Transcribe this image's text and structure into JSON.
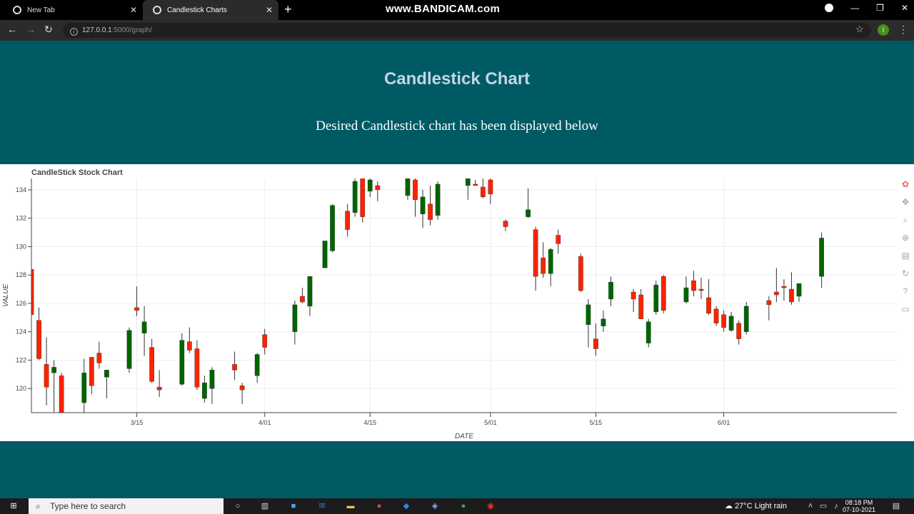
{
  "browser": {
    "tabs": [
      {
        "label": "New Tab",
        "active": false
      },
      {
        "label": "Candlestick Charts",
        "active": true
      }
    ],
    "watermark": "www.BANDICAM.com",
    "url_host": "127.0.0.1",
    "url_path": ":5000/graph/",
    "profile_initial": "I"
  },
  "page": {
    "title": "Candlestick Chart",
    "subtitle": "Desired Candlestick chart has been displayed below"
  },
  "chart_data": {
    "type": "candlestick",
    "title": "CandleStick Stock Chart",
    "xlabel": "DATE",
    "ylabel": "VALUE",
    "ylim": [
      118.3,
      134.8
    ],
    "y_ticks": [
      120,
      122,
      124,
      126,
      128,
      130,
      132,
      134
    ],
    "y_tick_labels": [
      "120",
      "122",
      "124",
      "126",
      "128",
      "130",
      "132",
      "134"
    ],
    "x_range": [
      "2021-03-01",
      "2021-06-24"
    ],
    "x_ticks": [
      "2021-03-15",
      "2021-04-01",
      "2021-04-15",
      "2021-05-01",
      "2021-05-15",
      "2021-06-01"
    ],
    "x_tick_labels": [
      "3/15",
      "4/01",
      "4/15",
      "5/01",
      "5/15",
      "6/01"
    ],
    "grid": true,
    "colors": {
      "up": "#006400",
      "down": "#ff2200",
      "wick": "#333333"
    },
    "candles": [
      {
        "date": "2021-03-01",
        "open": 128.4,
        "high": 128.7,
        "low": 125.2,
        "close": 125.2
      },
      {
        "date": "2021-03-02",
        "open": 124.8,
        "high": 125.7,
        "low": 122.0,
        "close": 122.1
      },
      {
        "date": "2021-03-03",
        "open": 121.7,
        "high": 123.6,
        "low": 118.8,
        "close": 120.1
      },
      {
        "date": "2021-03-04",
        "open": 121.1,
        "high": 122.0,
        "low": 118.3,
        "close": 121.5
      },
      {
        "date": "2021-03-05",
        "open": 120.9,
        "high": 121.1,
        "low": 118.3,
        "close": 118.3
      },
      {
        "date": "2021-03-08",
        "open": 119.0,
        "high": 122.1,
        "low": 118.3,
        "close": 121.1
      },
      {
        "date": "2021-03-09",
        "open": 122.2,
        "high": 122.2,
        "low": 119.6,
        "close": 120.2
      },
      {
        "date": "2021-03-10",
        "open": 122.5,
        "high": 123.3,
        "low": 121.4,
        "close": 121.8
      },
      {
        "date": "2021-03-11",
        "open": 120.8,
        "high": 121.3,
        "low": 119.3,
        "close": 121.3
      },
      {
        "date": "2021-03-14",
        "open": 121.4,
        "high": 124.3,
        "low": 121.1,
        "close": 124.1
      },
      {
        "date": "2021-03-15",
        "open": 125.7,
        "high": 127.2,
        "low": 125.1,
        "close": 125.5
      },
      {
        "date": "2021-03-16",
        "open": 123.9,
        "high": 125.8,
        "low": 122.3,
        "close": 124.7
      },
      {
        "date": "2021-03-17",
        "open": 122.9,
        "high": 123.5,
        "low": 120.4,
        "close": 120.5
      },
      {
        "date": "2021-03-18",
        "open": 120.1,
        "high": 121.3,
        "low": 119.4,
        "close": 119.9
      },
      {
        "date": "2021-03-21",
        "open": 120.3,
        "high": 123.9,
        "low": 120.2,
        "close": 123.4
      },
      {
        "date": "2021-03-22",
        "open": 123.3,
        "high": 124.3,
        "low": 122.5,
        "close": 122.7
      },
      {
        "date": "2021-03-23",
        "open": 122.8,
        "high": 123.4,
        "low": 119.9,
        "close": 120.1
      },
      {
        "date": "2021-03-24",
        "open": 119.3,
        "high": 120.9,
        "low": 119.0,
        "close": 120.4
      },
      {
        "date": "2021-03-25",
        "open": 120.0,
        "high": 121.5,
        "low": 118.9,
        "close": 121.3
      },
      {
        "date": "2021-03-28",
        "open": 121.7,
        "high": 122.6,
        "low": 120.6,
        "close": 121.3
      },
      {
        "date": "2021-03-29",
        "open": 120.2,
        "high": 120.4,
        "low": 118.9,
        "close": 119.9
      },
      {
        "date": "2021-03-31",
        "open": 120.9,
        "high": 122.5,
        "low": 120.4,
        "close": 122.4
      },
      {
        "date": "2021-04-01",
        "open": 123.8,
        "high": 124.2,
        "low": 122.4,
        "close": 122.9
      },
      {
        "date": "2021-04-05",
        "open": 124.0,
        "high": 126.2,
        "low": 123.1,
        "close": 125.9
      },
      {
        "date": "2021-04-06",
        "open": 126.5,
        "high": 127.1,
        "low": 126.0,
        "close": 126.1
      },
      {
        "date": "2021-04-07",
        "open": 125.8,
        "high": 127.6,
        "low": 125.1,
        "close": 127.9
      },
      {
        "date": "2021-04-09",
        "open": 128.5,
        "high": 128.7,
        "low": 128.5,
        "close": 130.4
      },
      {
        "date": "2021-04-10",
        "open": 129.7,
        "high": 133.0,
        "low": 129.6,
        "close": 132.9
      },
      {
        "date": "2021-04-12",
        "open": 132.5,
        "high": 133.0,
        "low": 130.7,
        "close": 131.2
      },
      {
        "date": "2021-04-13",
        "open": 132.4,
        "high": 134.9,
        "low": 132.1,
        "close": 134.6
      },
      {
        "date": "2021-04-14",
        "open": 134.9,
        "high": 134.9,
        "low": 131.7,
        "close": 132.1
      },
      {
        "date": "2021-04-15",
        "open": 133.9,
        "high": 134.9,
        "low": 133.5,
        "close": 134.7
      },
      {
        "date": "2021-04-16",
        "open": 134.3,
        "high": 134.6,
        "low": 133.2,
        "close": 134.0
      },
      {
        "date": "2021-04-20",
        "open": 133.6,
        "high": 134.6,
        "low": 133.3,
        "close": 134.8
      },
      {
        "date": "2021-04-21",
        "open": 134.7,
        "high": 134.9,
        "low": 132.1,
        "close": 133.3
      },
      {
        "date": "2021-04-22",
        "open": 132.3,
        "high": 134.0,
        "low": 131.3,
        "close": 133.5
      },
      {
        "date": "2021-04-23",
        "open": 133.0,
        "high": 134.3,
        "low": 131.5,
        "close": 131.9
      },
      {
        "date": "2021-04-24",
        "open": 132.2,
        "high": 134.6,
        "low": 131.9,
        "close": 134.4
      },
      {
        "date": "2021-04-28",
        "open": 134.3,
        "high": 134.7,
        "low": 133.3,
        "close": 134.8
      },
      {
        "date": "2021-04-29",
        "open": 134.4,
        "high": 134.7,
        "low": 134.3,
        "close": 134.3
      },
      {
        "date": "2021-04-30",
        "open": 134.2,
        "high": 134.8,
        "low": 133.4,
        "close": 133.5
      },
      {
        "date": "2021-05-01",
        "open": 134.7,
        "high": 134.8,
        "low": 133.0,
        "close": 133.7
      },
      {
        "date": "2021-05-03",
        "open": 131.8,
        "high": 131.9,
        "low": 131.1,
        "close": 131.4
      },
      {
        "date": "2021-05-06",
        "open": 132.1,
        "high": 134.1,
        "low": 132.0,
        "close": 132.6
      },
      {
        "date": "2021-05-07",
        "open": 131.2,
        "high": 131.4,
        "low": 126.9,
        "close": 127.9
      },
      {
        "date": "2021-05-08",
        "open": 129.2,
        "high": 130.3,
        "low": 127.8,
        "close": 128.1
      },
      {
        "date": "2021-05-09",
        "open": 128.1,
        "high": 129.9,
        "low": 127.2,
        "close": 129.8
      },
      {
        "date": "2021-05-10",
        "open": 130.8,
        "high": 131.2,
        "low": 129.5,
        "close": 130.2
      },
      {
        "date": "2021-05-13",
        "open": 129.3,
        "high": 129.5,
        "low": 126.8,
        "close": 126.9
      },
      {
        "date": "2021-05-14",
        "open": 124.5,
        "high": 126.3,
        "low": 122.9,
        "close": 125.9
      },
      {
        "date": "2021-05-15",
        "open": 123.5,
        "high": 124.6,
        "low": 122.3,
        "close": 122.8
      },
      {
        "date": "2021-05-16",
        "open": 124.4,
        "high": 125.5,
        "low": 124.0,
        "close": 124.9
      },
      {
        "date": "2021-05-17",
        "open": 126.3,
        "high": 127.9,
        "low": 125.8,
        "close": 127.5
      },
      {
        "date": "2021-05-20",
        "open": 126.8,
        "high": 127.0,
        "low": 125.4,
        "close": 126.3
      },
      {
        "date": "2021-05-21",
        "open": 126.6,
        "high": 127.0,
        "low": 124.9,
        "close": 124.9
      },
      {
        "date": "2021-05-22",
        "open": 123.2,
        "high": 124.9,
        "low": 122.9,
        "close": 124.7
      },
      {
        "date": "2021-05-23",
        "open": 125.4,
        "high": 127.6,
        "low": 125.2,
        "close": 127.3
      },
      {
        "date": "2021-05-24",
        "open": 127.9,
        "high": 128.0,
        "low": 125.3,
        "close": 125.5
      },
      {
        "date": "2021-05-27",
        "open": 126.1,
        "high": 127.9,
        "low": 126.0,
        "close": 127.1
      },
      {
        "date": "2021-05-28",
        "open": 127.6,
        "high": 128.3,
        "low": 126.5,
        "close": 126.9
      },
      {
        "date": "2021-05-29",
        "open": 127.0,
        "high": 127.8,
        "low": 126.3,
        "close": 126.9
      },
      {
        "date": "2021-05-30",
        "open": 126.4,
        "high": 127.7,
        "low": 125.2,
        "close": 125.3
      },
      {
        "date": "2021-05-31",
        "open": 125.6,
        "high": 125.8,
        "low": 124.4,
        "close": 124.6
      },
      {
        "date": "2021-06-01",
        "open": 125.2,
        "high": 125.5,
        "low": 124.0,
        "close": 124.3
      },
      {
        "date": "2021-06-02",
        "open": 124.1,
        "high": 125.4,
        "low": 124.0,
        "close": 125.1
      },
      {
        "date": "2021-06-03",
        "open": 124.6,
        "high": 124.8,
        "low": 123.1,
        "close": 123.5
      },
      {
        "date": "2021-06-04",
        "open": 124.0,
        "high": 126.1,
        "low": 123.8,
        "close": 125.8
      },
      {
        "date": "2021-06-07",
        "open": 126.2,
        "high": 126.5,
        "low": 124.8,
        "close": 125.9
      },
      {
        "date": "2021-06-08",
        "open": 126.8,
        "high": 128.5,
        "low": 126.1,
        "close": 126.6
      },
      {
        "date": "2021-06-09",
        "open": 127.2,
        "high": 127.7,
        "low": 126.2,
        "close": 127.1
      },
      {
        "date": "2021-06-10",
        "open": 127.0,
        "high": 128.2,
        "low": 125.9,
        "close": 126.1
      },
      {
        "date": "2021-06-11",
        "open": 126.5,
        "high": 127.4,
        "low": 126.1,
        "close": 127.4
      },
      {
        "date": "2021-06-14",
        "open": 127.9,
        "high": 131.0,
        "low": 127.1,
        "close": 130.6
      }
    ]
  },
  "taskbar": {
    "search_placeholder": "Type here to search",
    "weather": "27°C  Light rain",
    "time": "08:18 PM",
    "date": "07-10-2021"
  }
}
